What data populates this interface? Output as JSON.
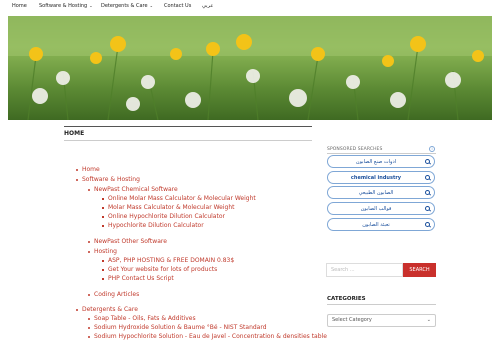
{
  "nav": {
    "items": [
      {
        "label": "Home",
        "dropdown": false
      },
      {
        "label": "Software & Hosting",
        "dropdown": true
      },
      {
        "label": "Detergents & Care",
        "dropdown": true
      },
      {
        "label": "Contact Us",
        "dropdown": false
      },
      {
        "label": "عربي",
        "dropdown": false
      }
    ]
  },
  "page": {
    "title": "HOME"
  },
  "tree": [
    {
      "level": 1,
      "label": "Home"
    },
    {
      "level": 1,
      "label": "Software & Hosting"
    },
    {
      "level": 2,
      "label": "NewPast Chemical Software"
    },
    {
      "level": 3,
      "label": "Online Molar Mass Calculator & Molecular Weight"
    },
    {
      "level": 3,
      "label": "Molar Mass Calculator & Molecular Weight"
    },
    {
      "level": 3,
      "label": "Online Hypochlorite Dilution Calculator"
    },
    {
      "level": 3,
      "label": "Hypochlorite Dilution Calculator"
    },
    {
      "level": 2,
      "label": "NewPast Other Software"
    },
    {
      "level": 2,
      "label": "Hosting"
    },
    {
      "level": 3,
      "label": "ASP, PHP HOSTING & FREE DOMAIN 0.83$"
    },
    {
      "level": 3,
      "label": "Get Your website for lots of products"
    },
    {
      "level": 3,
      "label": "PHP Contact Us Script"
    },
    {
      "level": 2,
      "label": "Coding Articles"
    },
    {
      "level": 1,
      "label": "Detergents & Care"
    },
    {
      "level": 2,
      "label": "Soap Table - Oils, Fats & Additives"
    },
    {
      "level": 2,
      "label": "Sodium Hydroxide Solution & Baume °Bé - NIST Standard"
    },
    {
      "level": 2,
      "label": "Sodium Hypochlorite Solution - Eau de Javel - Concentration & densities table"
    }
  ],
  "sidebar": {
    "sponsored_label": "SPONSORED SEARCHES",
    "sponsored": [
      {
        "label": "ادوات صنع الصابون",
        "bold": false
      },
      {
        "label": "chemical industry",
        "bold": true
      },
      {
        "label": "الصابون الطبيعي",
        "bold": false
      },
      {
        "label": "قوالب الصابون",
        "bold": false
      },
      {
        "label": "تعبئة الصابون",
        "bold": false
      }
    ],
    "search": {
      "placeholder": "Search ...",
      "button": "SEARCH"
    },
    "categories": {
      "label": "CATEGORIES",
      "select": "Select Category"
    }
  },
  "colors": {
    "accent": "#c9302c",
    "link": "#c0392b",
    "sponsored_border": "#7fa7d6",
    "sponsored_text": "#1a4f9c"
  }
}
